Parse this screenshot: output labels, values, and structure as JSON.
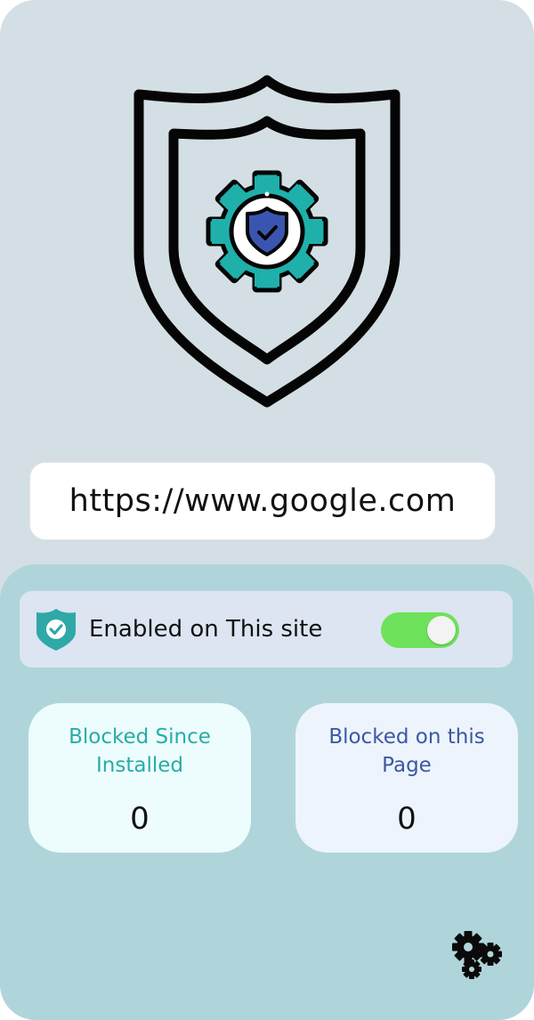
{
  "site": {
    "url": "https://www.google.com"
  },
  "toggle": {
    "label": "Enabled on This site",
    "enabled": true
  },
  "stats": {
    "since_installed": {
      "label": "Blocked Since Installed",
      "value": "0"
    },
    "this_page": {
      "label": "Blocked on this Page",
      "value": "0"
    }
  },
  "colors": {
    "background": "#d3dfe5",
    "panel": "#afd5db",
    "accent_teal": "#27ada6",
    "accent_blue": "#3c57a6",
    "toggle_on": "#6ee25a"
  },
  "icons": {
    "logo": "shield-gear-icon",
    "toggle_badge": "shield-check-icon",
    "settings": "gears-icon"
  }
}
